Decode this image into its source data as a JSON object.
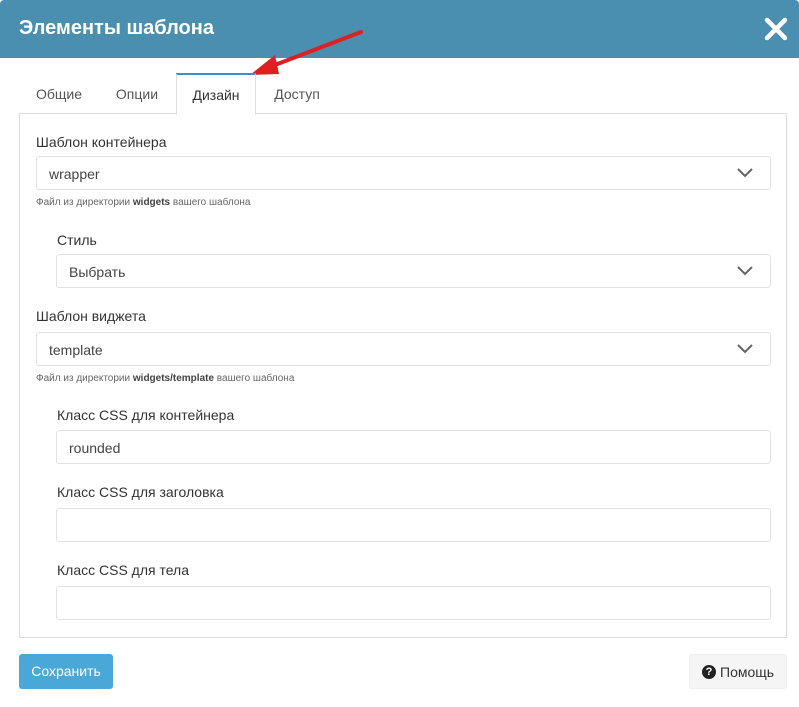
{
  "modal": {
    "title": "Элементы шаблона"
  },
  "tabs": [
    {
      "label": "Общие",
      "active": false
    },
    {
      "label": "Опции",
      "active": false
    },
    {
      "label": "Дизайн",
      "active": true
    },
    {
      "label": "Доступ",
      "active": false
    }
  ],
  "form": {
    "container_template": {
      "label": "Шаблон контейнера",
      "value": "wrapper",
      "help_prefix": "Файл из директории ",
      "help_bold": "widgets",
      "help_suffix": " вашего шаблона"
    },
    "style": {
      "label": "Стиль",
      "value": "Выбрать"
    },
    "widget_template": {
      "label": "Шаблон виджета",
      "value": "template",
      "help_prefix": "Файл из директории ",
      "help_bold": "widgets/template",
      "help_suffix": " вашего шаблона"
    },
    "container_css": {
      "label": "Класс CSS для контейнера",
      "value": "rounded"
    },
    "header_css": {
      "label": "Класс CSS для заголовка",
      "value": ""
    },
    "body_css": {
      "label": "Класс CSS для тела",
      "value": ""
    }
  },
  "footer": {
    "save_label": "Сохранить",
    "help_label": "Помощь"
  },
  "colors": {
    "header": "#4a8fb0",
    "save_button": "#4aa8d8",
    "annotation_arrow": "#e02020"
  },
  "icons": [
    "close-icon",
    "chevron-down-icon",
    "question-circle-icon",
    "annotation-arrow"
  ]
}
